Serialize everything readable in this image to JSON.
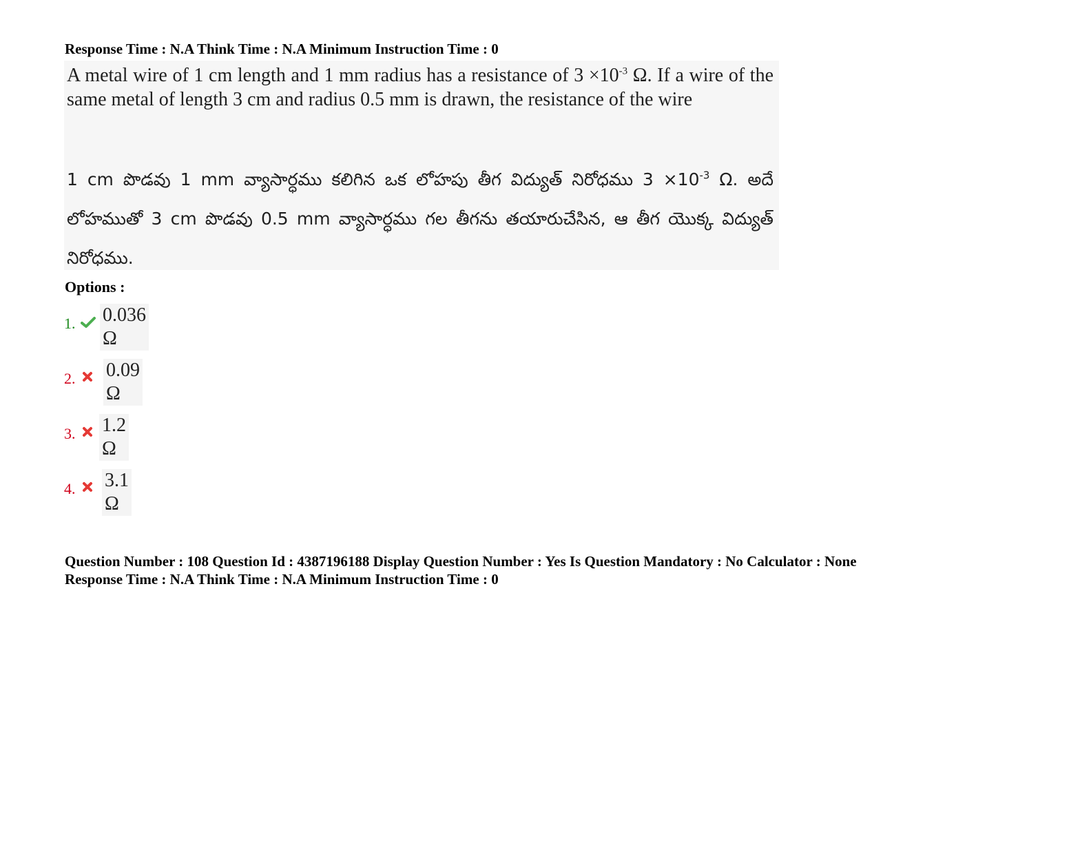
{
  "header": {
    "timing_line": "Response Time : N.A Think Time : N.A Minimum Instruction Time : 0"
  },
  "question": {
    "english_before": "A metal wire of 1 cm length and 1 mm radius has a resistance of 3 ×10",
    "english_exp": "-3",
    "english_after": " Ω.  If a wire of the same metal of length 3 cm and radius 0.5 mm is drawn, the resistance of the wire",
    "telugu_before": "1 cm పొడవు 1 mm వ్యాసార్ధము కలిగిన ఒక లోహపు తీగ విద్యుత్ నిరోధము 3 ×10",
    "telugu_exp": "-3",
    "telugu_after": " Ω. అదే లోహముతో 3 cm పొడవు 0.5 mm వ్యాసార్ధము గల తీగను తయారుచేసిన, ఆ తీగ యొక్క విద్యుత్ నిరోధము."
  },
  "options_label": "Options :",
  "options": [
    {
      "number": "1.",
      "value": "0.036 Ω",
      "status": "correct",
      "icon": "check-icon",
      "color": "#4caf50"
    },
    {
      "number": "2.",
      "value": "0.09 Ω",
      "status": "wrong",
      "icon": "cross-icon",
      "color": "#e53935"
    },
    {
      "number": "3.",
      "value": "1.2 Ω",
      "status": "wrong",
      "icon": "cross-icon",
      "color": "#e53935"
    },
    {
      "number": "4.",
      "value": "3.1 Ω",
      "status": "wrong",
      "icon": "cross-icon",
      "color": "#e53935"
    }
  ],
  "footer": {
    "question_line": "Question Number : 108 Question Id : 4387196188 Display Question Number : Yes Is Question Mandatory : No Calculator : None",
    "timing_line": "Response Time : N.A Think Time : N.A Minimum Instruction Time : 0"
  }
}
